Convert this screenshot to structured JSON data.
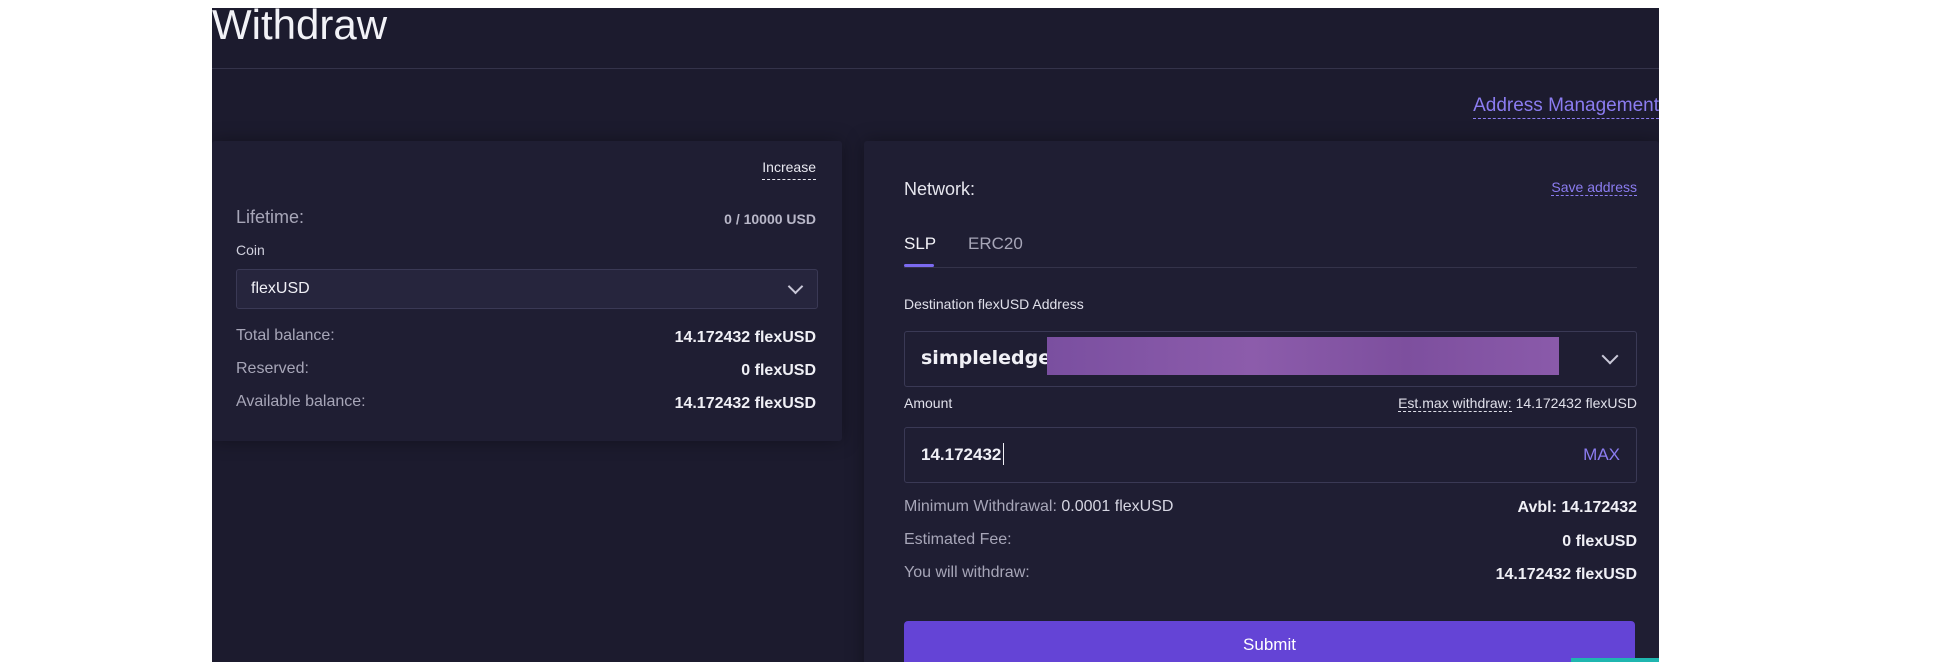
{
  "page": {
    "title": "Withdraw",
    "address_management": "Address Management"
  },
  "left_panel": {
    "increase": "Increase",
    "lifetime_label": "Lifetime:",
    "lifetime_value": "0 / 10000 USD",
    "coin_label": "Coin",
    "coin_selected": "flexUSD",
    "total_balance_label": "Total balance:",
    "total_balance_value": "14.172432 flexUSD",
    "reserved_label": "Reserved:",
    "reserved_value": "0 flexUSD",
    "available_label": "Available balance:",
    "available_value": "14.172432 flexUSD"
  },
  "right_panel": {
    "network_label": "Network:",
    "save_address": "Save address",
    "tabs": [
      {
        "label": "SLP",
        "active": true
      },
      {
        "label": "ERC20",
        "active": false
      }
    ],
    "destination_label": "Destination flexUSD Address",
    "destination_prefix": "simpleledger:",
    "amount_label": "Amount",
    "est_max_label": "Est.max withdraw:",
    "est_max_value": "14.172432 flexUSD",
    "amount_value": "14.172432",
    "max_button": "MAX",
    "min_withdrawal_label": "Minimum Withdrawal:",
    "min_withdrawal_value": "0.0001 flexUSD",
    "avbl": "Avbl: 14.172432",
    "fee_label": "Estimated Fee:",
    "fee_value": "0 flexUSD",
    "withdraw_label": "You will withdraw:",
    "withdraw_value": "14.172432 flexUSD",
    "submit": "Submit"
  },
  "colors": {
    "background": "#1c1b2e",
    "panel": "#1f1e33",
    "accent": "#6444d6",
    "link": "#8b7cf0",
    "redaction": "#8a5aaa"
  }
}
